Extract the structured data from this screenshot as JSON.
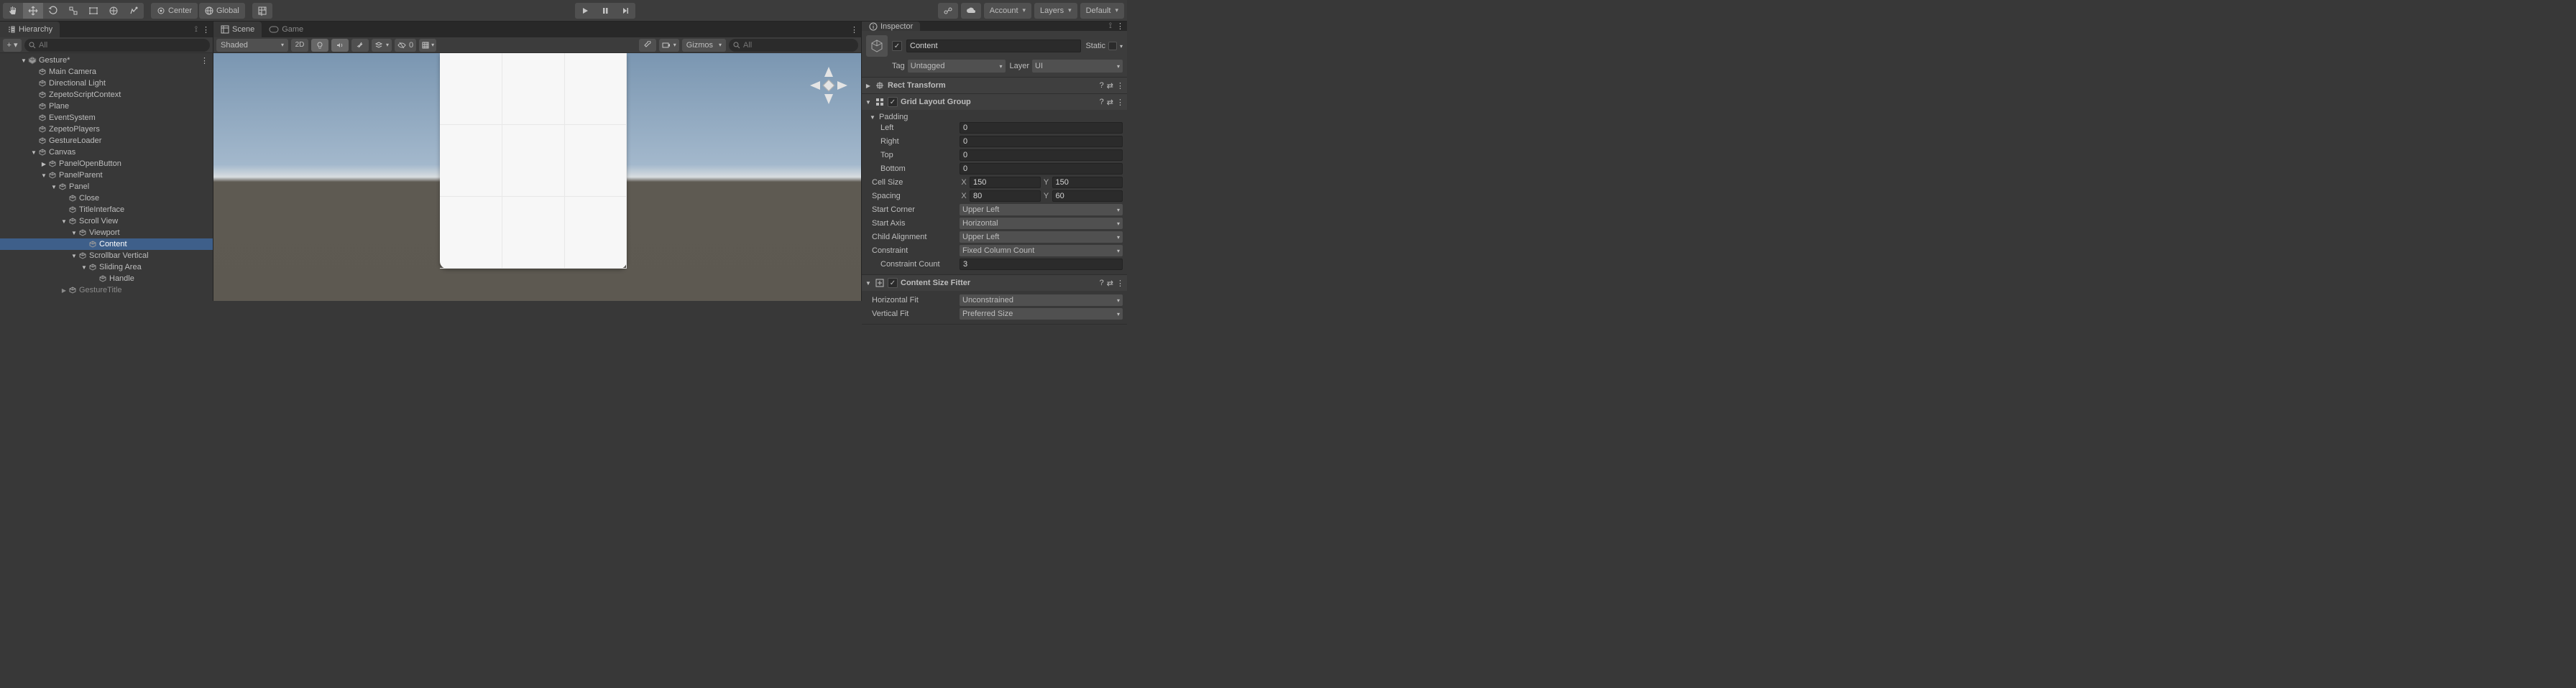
{
  "toolbar": {
    "center_label": "Center",
    "global_label": "Global",
    "account_label": "Account",
    "layers_label": "Layers",
    "layout_label": "Default"
  },
  "hierarchy": {
    "title": "Hierarchy",
    "search_placeholder": "All",
    "tree": [
      {
        "label": "Gesture*",
        "depth": 0,
        "fold": "down",
        "icon": "scene",
        "kebab": true
      },
      {
        "label": "Main Camera",
        "depth": 1,
        "icon": "go"
      },
      {
        "label": "Directional Light",
        "depth": 1,
        "icon": "go"
      },
      {
        "label": "ZepetoScriptContext",
        "depth": 1,
        "icon": "go"
      },
      {
        "label": "Plane",
        "depth": 1,
        "icon": "go"
      },
      {
        "label": "EventSystem",
        "depth": 1,
        "icon": "go"
      },
      {
        "label": "ZepetoPlayers",
        "depth": 1,
        "icon": "go"
      },
      {
        "label": "GestureLoader",
        "depth": 1,
        "icon": "go"
      },
      {
        "label": "Canvas",
        "depth": 1,
        "fold": "down",
        "icon": "go"
      },
      {
        "label": "PanelOpenButton",
        "depth": 2,
        "fold": "right",
        "icon": "go"
      },
      {
        "label": "PanelParent",
        "depth": 2,
        "fold": "down",
        "icon": "go"
      },
      {
        "label": "Panel",
        "depth": 3,
        "fold": "down",
        "icon": "go"
      },
      {
        "label": "Close",
        "depth": 4,
        "icon": "go"
      },
      {
        "label": "TitleInterface",
        "depth": 4,
        "icon": "go"
      },
      {
        "label": "Scroll View",
        "depth": 4,
        "fold": "down",
        "icon": "go"
      },
      {
        "label": "Viewport",
        "depth": 5,
        "fold": "down",
        "icon": "go"
      },
      {
        "label": "Content",
        "depth": 6,
        "icon": "go",
        "selected": true
      },
      {
        "label": "Scrollbar Vertical",
        "depth": 5,
        "fold": "down",
        "icon": "go"
      },
      {
        "label": "Sliding Area",
        "depth": 6,
        "fold": "down",
        "icon": "go"
      },
      {
        "label": "Handle",
        "depth": 7,
        "icon": "go"
      },
      {
        "label": "GestureTitle",
        "depth": 4,
        "fold": "right",
        "icon": "go",
        "dim": true
      }
    ]
  },
  "scene": {
    "scene_tab": "Scene",
    "game_tab": "Game",
    "draw_mode": "Shaded",
    "twod": "2D",
    "gizmos_label": "Gizmos",
    "search_placeholder": "All",
    "zero": "0"
  },
  "inspector": {
    "title": "Inspector",
    "name": "Content",
    "static_label": "Static",
    "tag_label": "Tag",
    "tag_value": "Untagged",
    "layer_label": "Layer",
    "layer_value": "UI",
    "rect_transform": {
      "title": "Rect Transform"
    },
    "grid": {
      "title": "Grid Layout Group",
      "padding_label": "Padding",
      "left_label": "Left",
      "left_value": "0",
      "right_label": "Right",
      "right_value": "0",
      "top_label": "Top",
      "top_value": "0",
      "bottom_label": "Bottom",
      "bottom_value": "0",
      "cellsize_label": "Cell Size",
      "cellsize_x": "150",
      "cellsize_y": "150",
      "spacing_label": "Spacing",
      "spacing_x": "80",
      "spacing_y": "60",
      "startcorner_label": "Start Corner",
      "startcorner_value": "Upper Left",
      "startaxis_label": "Start Axis",
      "startaxis_value": "Horizontal",
      "childalign_label": "Child Alignment",
      "childalign_value": "Upper Left",
      "constraint_label": "Constraint",
      "constraint_value": "Fixed Column Count",
      "constraintcount_label": "Constraint Count",
      "constraintcount_value": "3"
    },
    "csf": {
      "title": "Content Size Fitter",
      "hfit_label": "Horizontal Fit",
      "hfit_value": "Unconstrained",
      "vfit_label": "Vertical Fit",
      "vfit_value": "Preferred Size"
    }
  }
}
